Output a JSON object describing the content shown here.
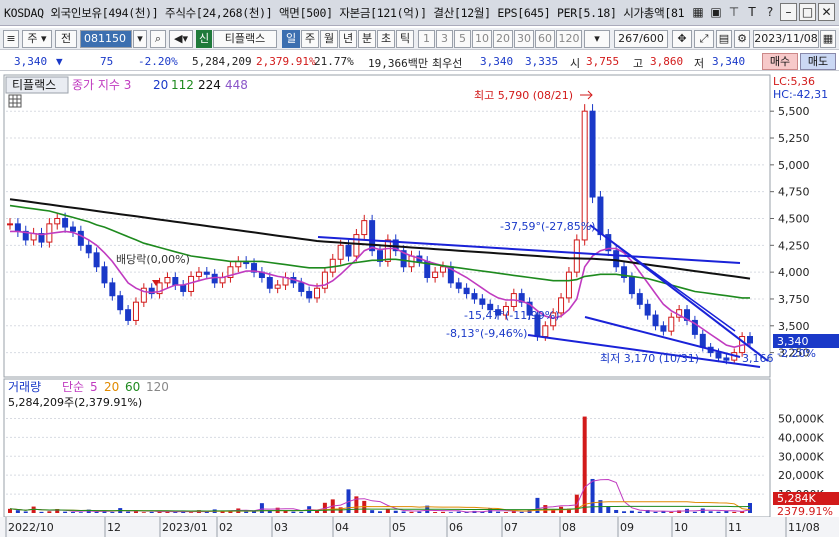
{
  "titlebar": {
    "info": "KOSDAQ 외국인보유[494(천)] 주식수[24,268(천)] 액면[500] 자본금[121(억)] 결산[12월] EPS[645] PER[5.18] 시가총액[81",
    "icons": [
      "grid-icon",
      "copy-icon",
      "pin-icon",
      "text-icon",
      "help-icon",
      "minimize-icon",
      "restore-icon",
      "close-icon"
    ],
    "icon_glyphs": [
      "▦",
      "▣",
      "⊤",
      "T",
      "?",
      "–",
      "□",
      "✕"
    ]
  },
  "toolbar": {
    "menu_icon": "≡",
    "type_select": "주",
    "prev_label": "전",
    "code_value": "081150",
    "stock_prefix": "신",
    "stock_name": "티플랙스",
    "periods": [
      "일",
      "주",
      "월",
      "년",
      "분",
      "초",
      "틱"
    ],
    "period_selected": "일",
    "intervals": [
      "1",
      "3",
      "5",
      "10",
      "20",
      "30",
      "60",
      "120"
    ],
    "count": "267/600",
    "date": "2023/11/08"
  },
  "quote": {
    "price": "3,340",
    "arrow": "▼",
    "change": "75",
    "change_rate": "-2.20%",
    "volume": "5,284,209",
    "volume_rate": "2,379.91%",
    "turnover_rate": "21.77%",
    "amount": "19,366백만",
    "best_label": "최우선",
    "best_ask": "3,340",
    "best_bid": "3,335",
    "open_label": "시",
    "open": "3,755",
    "high_label": "고",
    "high": "3,860",
    "low_label": "저",
    "low": "3,340",
    "buy_label": "매수",
    "sell_label": "매도"
  },
  "chart_data": [
    {
      "type": "line",
      "name": "price",
      "title_tab": "티플랙스",
      "legend": {
        "label": "종가 지수 3",
        "periods": [
          "20",
          "112",
          "224",
          "448"
        ],
        "colors": [
          "#c03bc0",
          "#1a39c8",
          "#1e8a1e",
          "#111111",
          "#8a55c8"
        ]
      },
      "y_ticks": [
        5500,
        5250,
        5000,
        4750,
        4500,
        4250,
        4000,
        3750,
        3500,
        3250
      ],
      "ylim": [
        3060,
        5800
      ],
      "x_ticks": [
        "2022/10",
        "12",
        "2023/01",
        "02",
        "03",
        "04",
        "05",
        "06",
        "07",
        "08",
        "09",
        "10",
        "11",
        "11/08"
      ],
      "annotations": {
        "high": "최고 5,790 (08/21)",
        "low": "최저 3,170 (10/31)",
        "ex_dividend": "배당락(0,00%)",
        "lc": "LC:5,36",
        "hc": "HC:-42,31",
        "trend1": "-37,59°(-27,85%)",
        "trend2": "-15,47°(-11,99%)",
        "trend3": "-8,13°(-9,46%)",
        "trend_end": "3,166",
        "current_price": "3,340",
        "current_rate": "-2.20%"
      },
      "series": [
        {
          "name": "종가",
          "color": "#1a39c8",
          "values": [
            4450,
            4380,
            4300,
            4360,
            4280,
            4450,
            4500,
            4420,
            4380,
            4250,
            4180,
            4050,
            3900,
            3780,
            3650,
            3550,
            3720,
            3850,
            3800,
            3900,
            3950,
            3880,
            3820,
            3960,
            4000,
            3980,
            3900,
            3950,
            4050,
            4100,
            4080,
            4000,
            3950,
            3850,
            3880,
            3950,
            3900,
            3820,
            3760,
            3850,
            4000,
            4120,
            4250,
            4150,
            4350,
            4480,
            4200,
            4100,
            4300,
            4200,
            4050,
            4150,
            4100,
            3950,
            4000,
            4050,
            3900,
            3850,
            3800,
            3750,
            3700,
            3650,
            3600,
            3680,
            3800,
            3720,
            3600,
            3400,
            3500,
            3620,
            3760,
            4000,
            4300,
            5500,
            4700,
            4350,
            4200,
            4050,
            3950,
            3800,
            3700,
            3600,
            3500,
            3450,
            3580,
            3650,
            3550,
            3420,
            3300,
            3250,
            3200,
            3180,
            3250,
            3400,
            3340
          ]
        },
        {
          "name": "20",
          "color": "#c03bc0",
          "values": [
            4380,
            4380,
            4370,
            4360,
            4350,
            4360,
            4370,
            4380,
            4370,
            4340,
            4300,
            4250,
            4180,
            4100,
            4000,
            3900,
            3850,
            3820,
            3810,
            3820,
            3850,
            3880,
            3880,
            3900,
            3920,
            3940,
            3950,
            3950,
            3970,
            3990,
            4010,
            4010,
            4000,
            3980,
            3960,
            3950,
            3930,
            3910,
            3880,
            3870,
            3880,
            3920,
            3980,
            4050,
            4120,
            4200,
            4230,
            4210,
            4220,
            4220,
            4180,
            4150,
            4130,
            4100,
            4080,
            4060,
            4030,
            3990,
            3950,
            3900,
            3850,
            3800,
            3760,
            3740,
            3740,
            3730,
            3700,
            3640,
            3590,
            3570,
            3590,
            3650,
            3750,
            4050,
            4150,
            4200,
            4220,
            4220,
            4180,
            4100,
            4000,
            3900,
            3800,
            3700,
            3640,
            3600,
            3560,
            3520,
            3470,
            3420,
            3370,
            3320,
            3300,
            3320,
            3330
          ]
        },
        {
          "name": "112",
          "color": "#1e8a1e",
          "values": [
            4620,
            4610,
            4600,
            4590,
            4580,
            4570,
            4550,
            4530,
            4510,
            4490,
            4470,
            4440,
            4420,
            4390,
            4360,
            4330,
            4300,
            4270,
            4250,
            4230,
            4210,
            4190,
            4170,
            4150,
            4140,
            4130,
            4120,
            4110,
            4100,
            4100,
            4100,
            4100,
            4100,
            4090,
            4080,
            4070,
            4060,
            4050,
            4040,
            4040,
            4040,
            4050,
            4060,
            4080,
            4090,
            4100,
            4110,
            4110,
            4120,
            4120,
            4110,
            4100,
            4090,
            4080,
            4070,
            4060,
            4050,
            4040,
            4030,
            4020,
            4010,
            4000,
            3990,
            3980,
            3970,
            3960,
            3950,
            3940,
            3930,
            3920,
            3920,
            3920,
            3930,
            3960,
            3970,
            3980,
            3980,
            3980,
            3970,
            3960,
            3950,
            3940,
            3920,
            3900,
            3880,
            3860,
            3840,
            3820,
            3810,
            3800,
            3790,
            3780,
            3770,
            3760,
            3760
          ]
        },
        {
          "name": "224",
          "color": "#111111",
          "values": [
            4680,
            4670,
            4660,
            4650,
            4640,
            4630,
            4620,
            4610,
            4600,
            4590,
            4580,
            4570,
            4560,
            4550,
            4540,
            4530,
            4520,
            4510,
            4500,
            4490,
            4480,
            4470,
            4460,
            4450,
            4440,
            4430,
            4420,
            4410,
            4400,
            4390,
            4380,
            4370,
            4360,
            4350,
            4340,
            4330,
            4320,
            4310,
            4300,
            4290,
            4285,
            4280,
            4275,
            4270,
            4265,
            4260,
            4255,
            4250,
            4245,
            4240,
            4235,
            4230,
            4225,
            4220,
            4215,
            4210,
            4205,
            4200,
            4195,
            4190,
            4185,
            4180,
            4175,
            4170,
            4165,
            4160,
            4155,
            4150,
            4145,
            4140,
            4135,
            4130,
            4128,
            4126,
            4124,
            4120,
            4115,
            4110,
            4100,
            4090,
            4080,
            4070,
            4060,
            4050,
            4040,
            4030,
            4020,
            4010,
            4000,
            3990,
            3980,
            3970,
            3960,
            3950,
            3940
          ]
        }
      ]
    },
    {
      "type": "bar",
      "name": "volume",
      "legend": {
        "label": "거래량",
        "kind": "단순",
        "periods": [
          "5",
          "20",
          "60",
          "120"
        ],
        "colors": [
          "#1a39c8",
          "#c03bc0",
          "#e08a00",
          "#1e8a1e",
          "#888888"
        ]
      },
      "y_ticks": [
        "50,000K",
        "40,000K",
        "30,000K",
        "20,000K",
        "10,000K"
      ],
      "ylim": [
        0,
        55000
      ],
      "current_volume": "5,284K",
      "current_rate": "2379.91%",
      "summary": "5,284,209주(2,379.91%)",
      "values": [
        2200,
        1500,
        800,
        3400,
        600,
        900,
        2100,
        700,
        500,
        400,
        1800,
        600,
        1100,
        500,
        2600,
        700,
        900,
        400,
        600,
        1200,
        800,
        500,
        700,
        400,
        1500,
        600,
        1900,
        800,
        1300,
        2400,
        700,
        900,
        5200,
        1100,
        2800,
        1200,
        700,
        600,
        3600,
        1800,
        5400,
        7200,
        3000,
        12500,
        8800,
        6400,
        1500,
        900,
        2100,
        1200,
        800,
        600,
        700,
        3900,
        500,
        600,
        400,
        700,
        500,
        1100,
        800,
        2600,
        700,
        500,
        900,
        600,
        1700,
        8000,
        4200,
        1800,
        3300,
        2300,
        9700,
        51000,
        18000,
        6800,
        3200,
        1600,
        900,
        1200,
        700,
        1600,
        600,
        800,
        500,
        1400,
        2200,
        600,
        2400,
        900,
        700,
        1100,
        600,
        800,
        5284
      ]
    }
  ]
}
